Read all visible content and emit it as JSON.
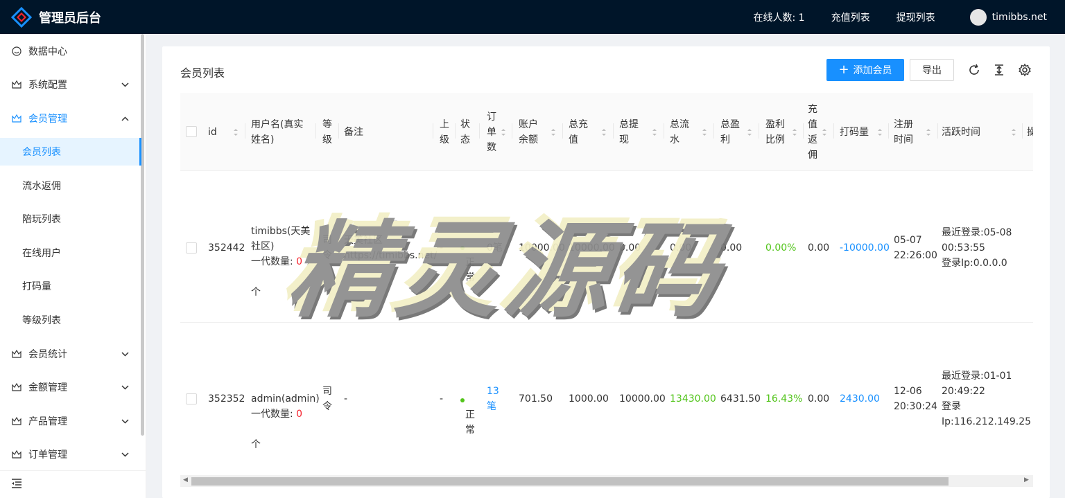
{
  "header": {
    "title": "管理员后台",
    "online_label": "在线人数: 1",
    "recharge_link": "充值列表",
    "withdraw_link": "提现列表",
    "username": "timibbs.net"
  },
  "sidebar": {
    "items": [
      {
        "label": "数据中心",
        "icon": "dashboard-icon"
      },
      {
        "label": "系统配置",
        "icon": "crown-icon"
      },
      {
        "label": "会员管理",
        "icon": "crown-icon"
      },
      {
        "label": "会员统计",
        "icon": "crown-icon"
      },
      {
        "label": "金额管理",
        "icon": "crown-icon"
      },
      {
        "label": "产品管理",
        "icon": "crown-icon"
      },
      {
        "label": "订单管理",
        "icon": "crown-icon"
      }
    ],
    "sub_items": [
      "会员列表",
      "流水返佣",
      "陪玩列表",
      "在线用户",
      "打码量",
      "等级列表"
    ],
    "active_sub": "会员列表"
  },
  "card": {
    "title": "会员列表",
    "add_button": "添加会员",
    "export_button": "导出"
  },
  "table": {
    "columns": [
      "id",
      "用户名(真实\n姓名)",
      "等\n级",
      "备注",
      "上\n级",
      "状\n态",
      "订\n单\n数",
      "账户\n余额",
      "总充\n值",
      "总提\n现",
      "总流\n水",
      "总盈\n利",
      "盈利\n比例",
      "充\n值\n返\n佣",
      "打码量",
      "注册\n时间",
      "活跃时间",
      "操"
    ],
    "rows": [
      {
        "id": "352442",
        "username": "timibbs(天美\n社区)",
        "gen_prefix": "一代数量: ",
        "gen_count": "0",
        "gen_suffix": "个",
        "level": "司\n令",
        "remark": "天美社区\nhttps://timibbs.net/",
        "parent": "-",
        "status": "正\n常",
        "orders": "0笔",
        "balance": "10000.00",
        "total_recharge": "10000.00",
        "total_withdraw": "0.00",
        "total_flow": "0.00",
        "total_profit": "0.00",
        "profit_ratio": "0.00%",
        "rebate": "0.00",
        "code_amount": "-10000.00",
        "register_time": "05-07\n22:26:00",
        "active_time": "最近登录:05-08\n00:53:55\n登录Ip:0.0.0.0"
      },
      {
        "id": "352352",
        "username": "admin(admin)",
        "gen_prefix": "一代数量: ",
        "gen_count": "0",
        "gen_suffix": "个",
        "level": "司\n令",
        "remark": "-",
        "parent": "-",
        "status": "正\n常",
        "orders": "13\n笔",
        "balance": "701.50",
        "total_recharge": "1000.00",
        "total_withdraw": "10000.00",
        "total_flow": "13430.00",
        "total_profit": "6431.50",
        "profit_ratio": "16.43%",
        "rebate": "0.00",
        "code_amount": "2430.00",
        "register_time": "12-06\n20:30:24",
        "active_time": "最近登录:01-01\n20:49:22\n登录\nIp:116.212.149.25"
      }
    ]
  },
  "watermark": "精灵源码",
  "colors": {
    "header_bg": "#001529",
    "accent": "#1890ff",
    "success": "#52c41a",
    "danger": "#f5222d"
  }
}
